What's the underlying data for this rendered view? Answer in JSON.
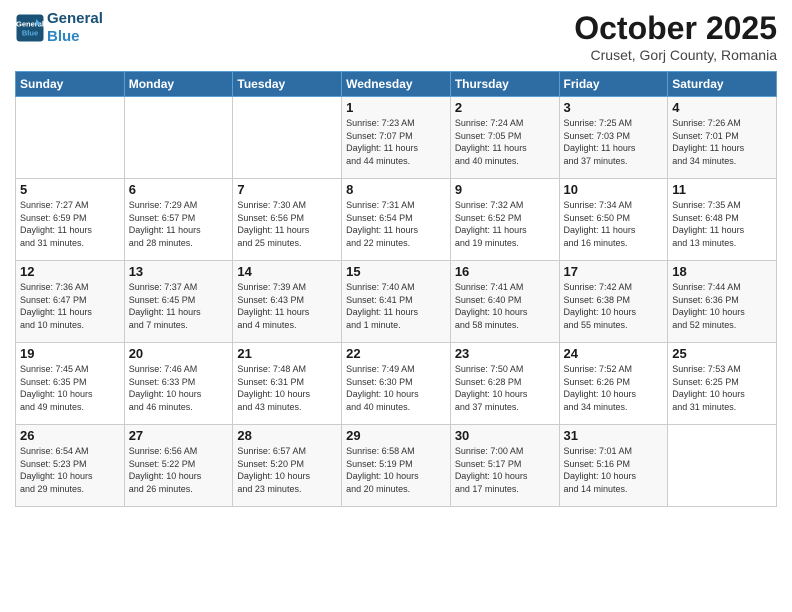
{
  "header": {
    "logo_line1": "General",
    "logo_line2": "Blue",
    "month": "October 2025",
    "location": "Cruset, Gorj County, Romania"
  },
  "days_of_week": [
    "Sunday",
    "Monday",
    "Tuesday",
    "Wednesday",
    "Thursday",
    "Friday",
    "Saturday"
  ],
  "weeks": [
    [
      {
        "day": "",
        "info": ""
      },
      {
        "day": "",
        "info": ""
      },
      {
        "day": "",
        "info": ""
      },
      {
        "day": "1",
        "info": "Sunrise: 7:23 AM\nSunset: 7:07 PM\nDaylight: 11 hours\nand 44 minutes."
      },
      {
        "day": "2",
        "info": "Sunrise: 7:24 AM\nSunset: 7:05 PM\nDaylight: 11 hours\nand 40 minutes."
      },
      {
        "day": "3",
        "info": "Sunrise: 7:25 AM\nSunset: 7:03 PM\nDaylight: 11 hours\nand 37 minutes."
      },
      {
        "day": "4",
        "info": "Sunrise: 7:26 AM\nSunset: 7:01 PM\nDaylight: 11 hours\nand 34 minutes."
      }
    ],
    [
      {
        "day": "5",
        "info": "Sunrise: 7:27 AM\nSunset: 6:59 PM\nDaylight: 11 hours\nand 31 minutes."
      },
      {
        "day": "6",
        "info": "Sunrise: 7:29 AM\nSunset: 6:57 PM\nDaylight: 11 hours\nand 28 minutes."
      },
      {
        "day": "7",
        "info": "Sunrise: 7:30 AM\nSunset: 6:56 PM\nDaylight: 11 hours\nand 25 minutes."
      },
      {
        "day": "8",
        "info": "Sunrise: 7:31 AM\nSunset: 6:54 PM\nDaylight: 11 hours\nand 22 minutes."
      },
      {
        "day": "9",
        "info": "Sunrise: 7:32 AM\nSunset: 6:52 PM\nDaylight: 11 hours\nand 19 minutes."
      },
      {
        "day": "10",
        "info": "Sunrise: 7:34 AM\nSunset: 6:50 PM\nDaylight: 11 hours\nand 16 minutes."
      },
      {
        "day": "11",
        "info": "Sunrise: 7:35 AM\nSunset: 6:48 PM\nDaylight: 11 hours\nand 13 minutes."
      }
    ],
    [
      {
        "day": "12",
        "info": "Sunrise: 7:36 AM\nSunset: 6:47 PM\nDaylight: 11 hours\nand 10 minutes."
      },
      {
        "day": "13",
        "info": "Sunrise: 7:37 AM\nSunset: 6:45 PM\nDaylight: 11 hours\nand 7 minutes."
      },
      {
        "day": "14",
        "info": "Sunrise: 7:39 AM\nSunset: 6:43 PM\nDaylight: 11 hours\nand 4 minutes."
      },
      {
        "day": "15",
        "info": "Sunrise: 7:40 AM\nSunset: 6:41 PM\nDaylight: 11 hours\nand 1 minute."
      },
      {
        "day": "16",
        "info": "Sunrise: 7:41 AM\nSunset: 6:40 PM\nDaylight: 10 hours\nand 58 minutes."
      },
      {
        "day": "17",
        "info": "Sunrise: 7:42 AM\nSunset: 6:38 PM\nDaylight: 10 hours\nand 55 minutes."
      },
      {
        "day": "18",
        "info": "Sunrise: 7:44 AM\nSunset: 6:36 PM\nDaylight: 10 hours\nand 52 minutes."
      }
    ],
    [
      {
        "day": "19",
        "info": "Sunrise: 7:45 AM\nSunset: 6:35 PM\nDaylight: 10 hours\nand 49 minutes."
      },
      {
        "day": "20",
        "info": "Sunrise: 7:46 AM\nSunset: 6:33 PM\nDaylight: 10 hours\nand 46 minutes."
      },
      {
        "day": "21",
        "info": "Sunrise: 7:48 AM\nSunset: 6:31 PM\nDaylight: 10 hours\nand 43 minutes."
      },
      {
        "day": "22",
        "info": "Sunrise: 7:49 AM\nSunset: 6:30 PM\nDaylight: 10 hours\nand 40 minutes."
      },
      {
        "day": "23",
        "info": "Sunrise: 7:50 AM\nSunset: 6:28 PM\nDaylight: 10 hours\nand 37 minutes."
      },
      {
        "day": "24",
        "info": "Sunrise: 7:52 AM\nSunset: 6:26 PM\nDaylight: 10 hours\nand 34 minutes."
      },
      {
        "day": "25",
        "info": "Sunrise: 7:53 AM\nSunset: 6:25 PM\nDaylight: 10 hours\nand 31 minutes."
      }
    ],
    [
      {
        "day": "26",
        "info": "Sunrise: 6:54 AM\nSunset: 5:23 PM\nDaylight: 10 hours\nand 29 minutes."
      },
      {
        "day": "27",
        "info": "Sunrise: 6:56 AM\nSunset: 5:22 PM\nDaylight: 10 hours\nand 26 minutes."
      },
      {
        "day": "28",
        "info": "Sunrise: 6:57 AM\nSunset: 5:20 PM\nDaylight: 10 hours\nand 23 minutes."
      },
      {
        "day": "29",
        "info": "Sunrise: 6:58 AM\nSunset: 5:19 PM\nDaylight: 10 hours\nand 20 minutes."
      },
      {
        "day": "30",
        "info": "Sunrise: 7:00 AM\nSunset: 5:17 PM\nDaylight: 10 hours\nand 17 minutes."
      },
      {
        "day": "31",
        "info": "Sunrise: 7:01 AM\nSunset: 5:16 PM\nDaylight: 10 hours\nand 14 minutes."
      },
      {
        "day": "",
        "info": ""
      }
    ]
  ]
}
